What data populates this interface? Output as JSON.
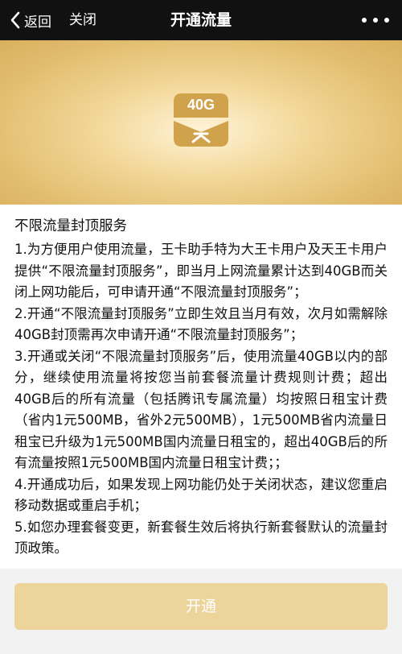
{
  "navbar": {
    "back_label": "返回",
    "close_label": "关闭",
    "title": "开通流量"
  },
  "banner": {
    "badge_text": "40G",
    "icon": "data-card-icon"
  },
  "content": {
    "heading": "不限流量封顶服务",
    "paragraphs": [
      "1.为方便用户使用流量，王卡助手特为大王卡用户及天王卡用户提供“不限流量封顶服务”，即当月上网流量累计达到40GB而关闭上网功能后，可申请开通“不限流量封顶服务”；",
      "2.开通“不限流量封顶服务”立即生效且当月有效，次月如需解除40GB封顶需再次申请开通“不限流量封顶服务”；",
      "3.开通或关闭“不限流量封顶服务”后，使用流量40GB以内的部分，继续使用流量将按您当前套餐流量计费规则计费；超出40GB后的所有流量（包括腾讯专属流量）均按照日租宝计费（省内1元500MB，省外2元500MB），1元500MB省内流量日租宝已升级为1元500MB国内流量日租宝的，超出40GB后的所有流量按照1元500MB国内流量日租宝计费；；",
      "4.开通成功后，如果发现上网功能仍处于关闭状态，建议您重启移动数据或重启手机；",
      "5.如您办理套餐变更，新套餐生效后将执行新套餐默认的流量封顶政策。"
    ]
  },
  "action": {
    "button_label": "开通"
  },
  "colors": {
    "navbar": "#111111",
    "banner_gold": "#e2bd6e",
    "button": "#ecd49b"
  }
}
